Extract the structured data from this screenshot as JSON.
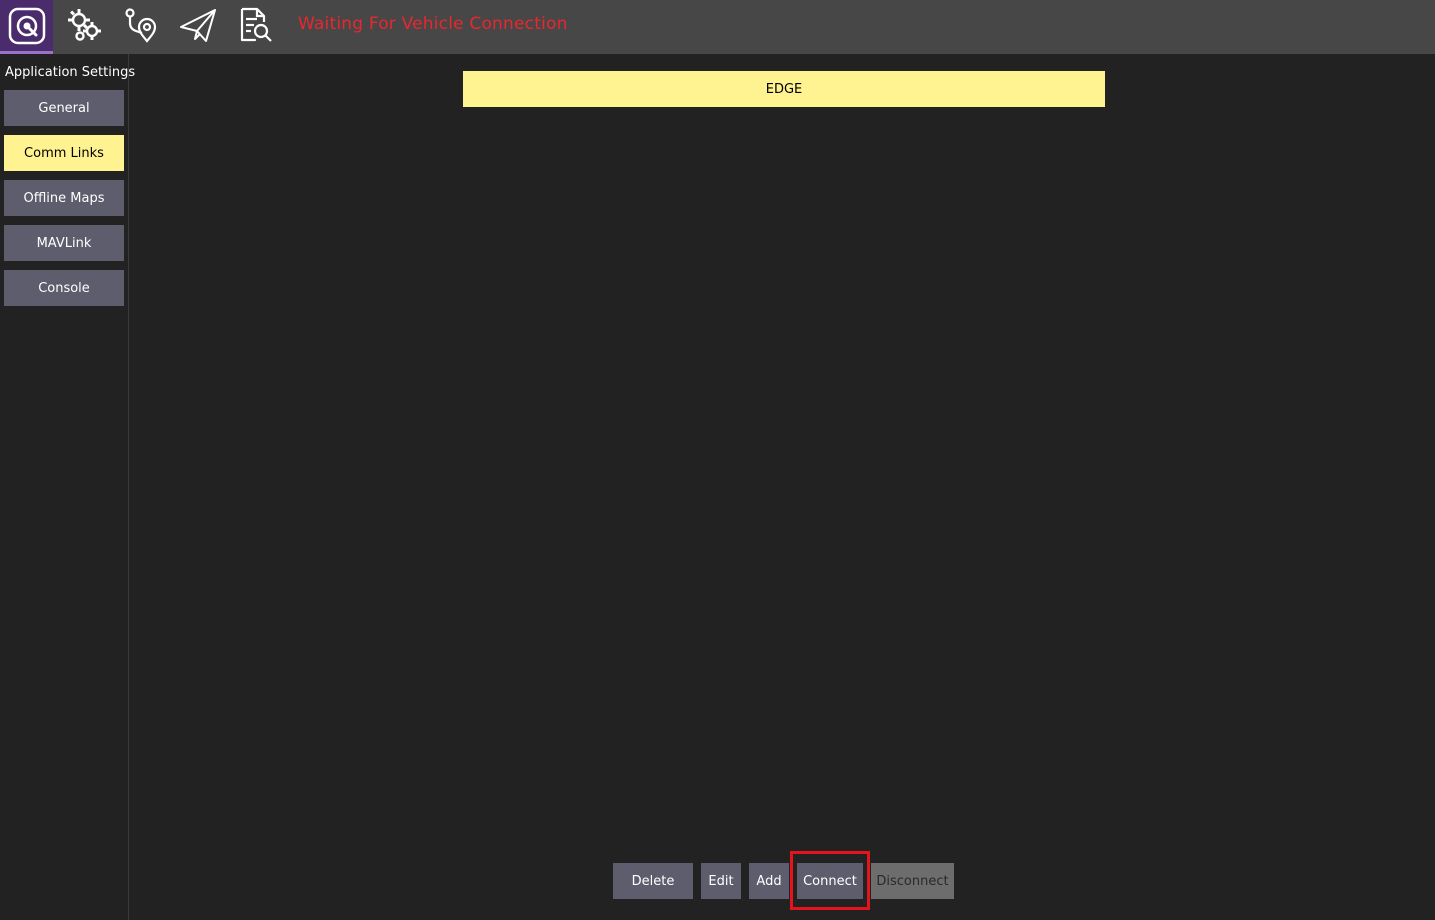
{
  "toolbar": {
    "status_text": "Waiting For Vehicle Connection",
    "icons": [
      "qgc-logo-icon",
      "settings-gear-icon",
      "plan-view-icon",
      "fly-view-icon",
      "analyze-view-icon"
    ]
  },
  "sidebar": {
    "title": "Application Settings",
    "items": [
      {
        "label": "General",
        "active": false
      },
      {
        "label": "Comm Links",
        "active": true
      },
      {
        "label": "Offline Maps",
        "active": false
      },
      {
        "label": "MAVLink",
        "active": false
      },
      {
        "label": "Console",
        "active": false
      }
    ]
  },
  "links": [
    {
      "name": "EDGE",
      "selected": true
    }
  ],
  "actions": {
    "delete": "Delete",
    "edit": "Edit",
    "add": "Add",
    "connect": "Connect",
    "disconnect": "Disconnect"
  },
  "colors": {
    "toolbar": "#474747",
    "background": "#222222",
    "button": "#5e5d6d",
    "selected": "#fff291",
    "status_red": "#e8272f",
    "highlight_red": "#e5131c",
    "logo_purple": "#4a2c6d"
  }
}
